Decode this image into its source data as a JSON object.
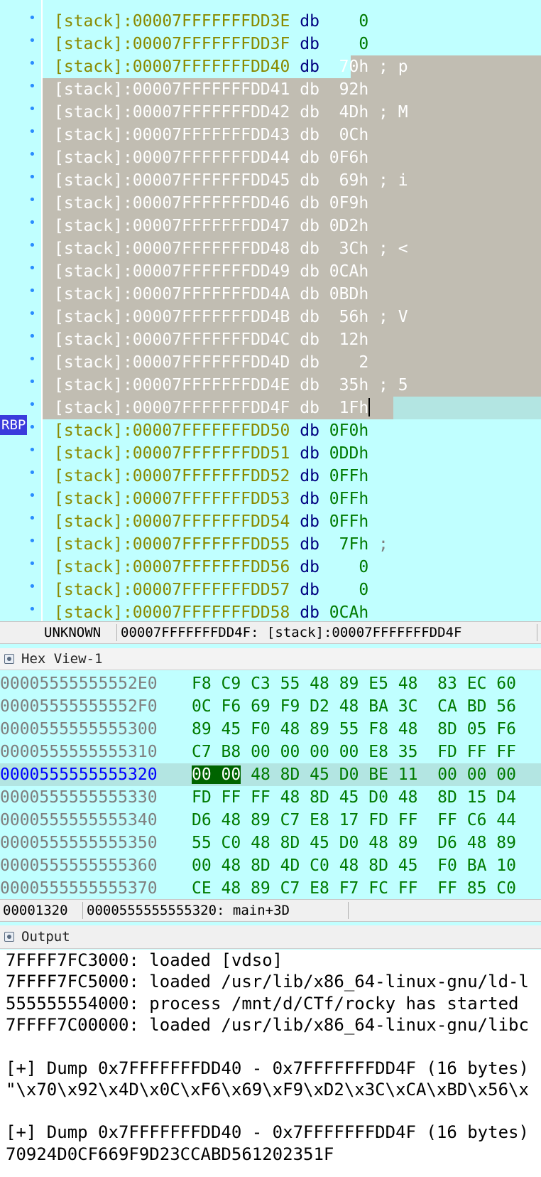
{
  "stack_view": {
    "rbp_label": "RBP",
    "rows": [
      {
        "seg": "[stack]",
        "addr": "00007FFFFFFFDD3E",
        "kw": "db",
        "val": "   0",
        "cmt": "",
        "sel": false,
        "cur": false
      },
      {
        "seg": "[stack]",
        "addr": "00007FFFFFFFDD3F",
        "kw": "db",
        "val": "   0",
        "cmt": "",
        "sel": false,
        "cur": false
      },
      {
        "seg": "[stack]",
        "addr": "00007FFFFFFFDD40",
        "kw": "db",
        "val": " 70h",
        "cmt": " ; p",
        "sel": "partial",
        "cur": false
      },
      {
        "seg": "[stack]",
        "addr": "00007FFFFFFFDD41",
        "kw": "db",
        "val": " 92h",
        "cmt": "",
        "sel": true,
        "cur": false
      },
      {
        "seg": "[stack]",
        "addr": "00007FFFFFFFDD42",
        "kw": "db",
        "val": " 4Dh",
        "cmt": " ; M",
        "sel": true,
        "cur": false
      },
      {
        "seg": "[stack]",
        "addr": "00007FFFFFFFDD43",
        "kw": "db",
        "val": " 0Ch",
        "cmt": "",
        "sel": true,
        "cur": false
      },
      {
        "seg": "[stack]",
        "addr": "00007FFFFFFFDD44",
        "kw": "db",
        "val": "0F6h",
        "cmt": "",
        "sel": true,
        "cur": false
      },
      {
        "seg": "[stack]",
        "addr": "00007FFFFFFFDD45",
        "kw": "db",
        "val": " 69h",
        "cmt": " ; i",
        "sel": true,
        "cur": false
      },
      {
        "seg": "[stack]",
        "addr": "00007FFFFFFFDD46",
        "kw": "db",
        "val": "0F9h",
        "cmt": "",
        "sel": true,
        "cur": false
      },
      {
        "seg": "[stack]",
        "addr": "00007FFFFFFFDD47",
        "kw": "db",
        "val": "0D2h",
        "cmt": "",
        "sel": true,
        "cur": false
      },
      {
        "seg": "[stack]",
        "addr": "00007FFFFFFFDD48",
        "kw": "db",
        "val": " 3Ch",
        "cmt": " ; <",
        "sel": true,
        "cur": false
      },
      {
        "seg": "[stack]",
        "addr": "00007FFFFFFFDD49",
        "kw": "db",
        "val": "0CAh",
        "cmt": "",
        "sel": true,
        "cur": false
      },
      {
        "seg": "[stack]",
        "addr": "00007FFFFFFFDD4A",
        "kw": "db",
        "val": "0BDh",
        "cmt": "",
        "sel": true,
        "cur": false
      },
      {
        "seg": "[stack]",
        "addr": "00007FFFFFFFDD4B",
        "kw": "db",
        "val": " 56h",
        "cmt": " ; V",
        "sel": true,
        "cur": false
      },
      {
        "seg": "[stack]",
        "addr": "00007FFFFFFFDD4C",
        "kw": "db",
        "val": " 12h",
        "cmt": "",
        "sel": true,
        "cur": false
      },
      {
        "seg": "[stack]",
        "addr": "00007FFFFFFFDD4D",
        "kw": "db",
        "val": "   2",
        "cmt": "",
        "sel": true,
        "cur": false
      },
      {
        "seg": "[stack]",
        "addr": "00007FFFFFFFDD4E",
        "kw": "db",
        "val": " 35h",
        "cmt": " ; 5",
        "sel": true,
        "cur": false
      },
      {
        "seg": "[stack]",
        "addr": "00007FFFFFFFDD4F",
        "kw": "db",
        "val": " 1Fh",
        "cmt": "",
        "sel": "cursor",
        "cur": true
      },
      {
        "seg": "[stack]",
        "addr": "00007FFFFFFFDD50",
        "kw": "db",
        "val": "0F0h",
        "cmt": "",
        "sel": false,
        "cur": false
      },
      {
        "seg": "[stack]",
        "addr": "00007FFFFFFFDD51",
        "kw": "db",
        "val": "0DDh",
        "cmt": "",
        "sel": false,
        "cur": false
      },
      {
        "seg": "[stack]",
        "addr": "00007FFFFFFFDD52",
        "kw": "db",
        "val": "0FFh",
        "cmt": "",
        "sel": false,
        "cur": false
      },
      {
        "seg": "[stack]",
        "addr": "00007FFFFFFFDD53",
        "kw": "db",
        "val": "0FFh",
        "cmt": "",
        "sel": false,
        "cur": false
      },
      {
        "seg": "[stack]",
        "addr": "00007FFFFFFFDD54",
        "kw": "db",
        "val": "0FFh",
        "cmt": "",
        "sel": false,
        "cur": false
      },
      {
        "seg": "[stack]",
        "addr": "00007FFFFFFFDD55",
        "kw": "db",
        "val": " 7Fh",
        "cmt": " ;",
        "sel": false,
        "cur": false
      },
      {
        "seg": "[stack]",
        "addr": "00007FFFFFFFDD56",
        "kw": "db",
        "val": "   0",
        "cmt": "",
        "sel": false,
        "cur": false
      },
      {
        "seg": "[stack]",
        "addr": "00007FFFFFFFDD57",
        "kw": "db",
        "val": "   0",
        "cmt": "",
        "sel": false,
        "cur": false
      },
      {
        "seg": "[stack]",
        "addr": "00007FFFFFFFDD58",
        "kw": "db",
        "val": "0CAh",
        "cmt": "",
        "sel": false,
        "cur": false
      }
    ]
  },
  "stack_status": {
    "segment_type": "UNKNOWN",
    "location": "00007FFFFFFFDD4F: [stack]:00007FFFFFFFDD4F"
  },
  "hex_view": {
    "title": "Hex View-1",
    "rows": [
      {
        "addr": "00005555555552E0",
        "bytes": "F8 C9 C3 55 48 89 E5 48  83 EC 60",
        "hl": ""
      },
      {
        "addr": "00005555555552F0",
        "bytes": "0C F6 69 F9 D2 48 BA 3C  CA BD 56",
        "hl": ""
      },
      {
        "addr": "0000555555555300",
        "bytes": "89 45 F0 48 89 55 F8 48  8D 05 F6",
        "hl": ""
      },
      {
        "addr": "0000555555555310",
        "bytes": "C7 B8 00 00 00 00 E8 35  FD FF FF",
        "hl": ""
      },
      {
        "addr": "0000555555555320",
        "bytes": " 48 8D 45 D0 BE 11  00 00 00",
        "hl": "00 00",
        "current": true
      },
      {
        "addr": "0000555555555330",
        "bytes": "FD FF FF 48 8D 45 D0 48  8D 15 D4",
        "hl": ""
      },
      {
        "addr": "0000555555555340",
        "bytes": "D6 48 89 C7 E8 17 FD FF  FF C6 44",
        "hl": ""
      },
      {
        "addr": "0000555555555350",
        "bytes": "55 C0 48 8D 45 D0 48 89  D6 48 89",
        "hl": ""
      },
      {
        "addr": "0000555555555360",
        "bytes": "00 48 8D 4D C0 48 8D 45  F0 BA 10",
        "hl": ""
      },
      {
        "addr": "0000555555555370",
        "bytes": "CE 48 89 C7 E8 F7 FC FF  FF 85 C0",
        "hl": ""
      }
    ]
  },
  "hex_status": {
    "offset": "00001320",
    "location": "0000555555555320: main+3D"
  },
  "output": {
    "title": "Output",
    "lines": [
      "7FFFF7FC3000: loaded [vdso]",
      "7FFFF7FC5000: loaded /usr/lib/x86_64-linux-gnu/ld-l",
      "555555554000: process /mnt/d/CTf/rocky has started",
      "7FFFF7C00000: loaded /usr/lib/x86_64-linux-gnu/libc",
      "",
      "[+] Dump 0x7FFFFFFFDD40 - 0x7FFFFFFFDD4F (16 bytes)",
      "\"\\x70\\x92\\x4D\\x0C\\xF6\\x69\\xF9\\xD2\\x3C\\xCA\\xBD\\x56\\x",
      "",
      "[+] Dump 0x7FFFFFFFDD40 - 0x7FFFFFFFDD4F (16 bytes)",
      "70924D0CF669F9D23CCABD561202351F"
    ]
  },
  "colors": {
    "background": "#c0ffff",
    "selection": "#c1bdb2",
    "current_line": "#b3e5e2",
    "address": "#8a8a00",
    "keyword": "#000080",
    "value": "#007a00",
    "register_tag": "#3b3bdc",
    "hex_highlight": "#006400"
  },
  "icons": {
    "hex_view": "hex-view-panel-icon",
    "output": "output-panel-icon",
    "breakpoint_dot": "line-dot-icon"
  }
}
